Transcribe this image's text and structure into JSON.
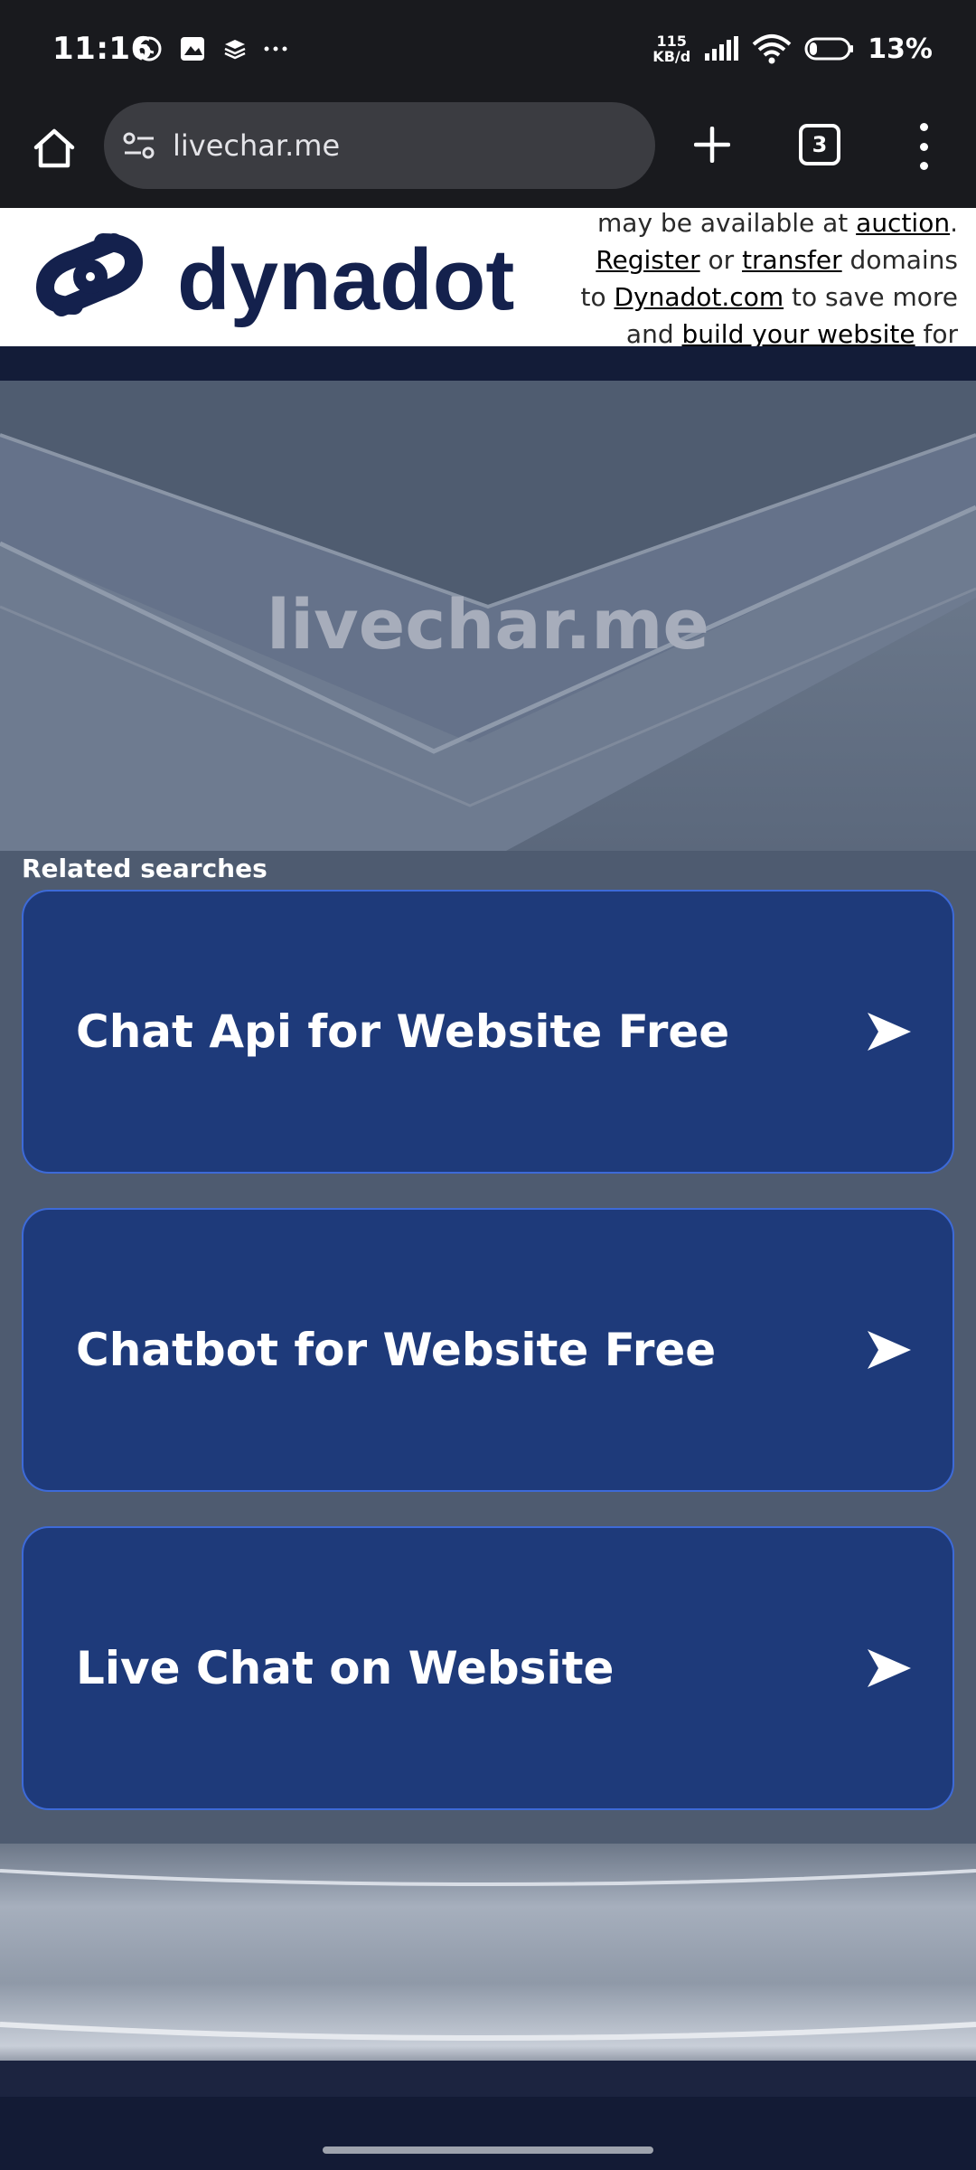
{
  "status_bar": {
    "time": "11:16",
    "speed_value": "115",
    "speed_unit": "KB/d",
    "battery": "13%"
  },
  "browser": {
    "url": "livechar.me",
    "tab_count": "3"
  },
  "banner": {
    "logo_text": "dynadot",
    "line1_pre": "may be available at ",
    "auction": "auction",
    "line1_post": ".",
    "register": "Register",
    "or": " or ",
    "transfer": "transfer",
    "domains": " domains",
    "to": "to ",
    "dynadot_com": "Dynadot.com",
    "save_more": " to save more",
    "and": "and ",
    "build": "build your website",
    "for": " for"
  },
  "hero": {
    "title": "livechar.me"
  },
  "related": {
    "title": "Related searches",
    "items": [
      {
        "label": "Chat Api for Website Free"
      },
      {
        "label": "Chatbot for Website Free"
      },
      {
        "label": "Live Chat on Website"
      }
    ]
  },
  "colors": {
    "card_bg": "#1e3a7a",
    "card_border": "#3d6ad8",
    "logo_navy": "#14214d"
  }
}
